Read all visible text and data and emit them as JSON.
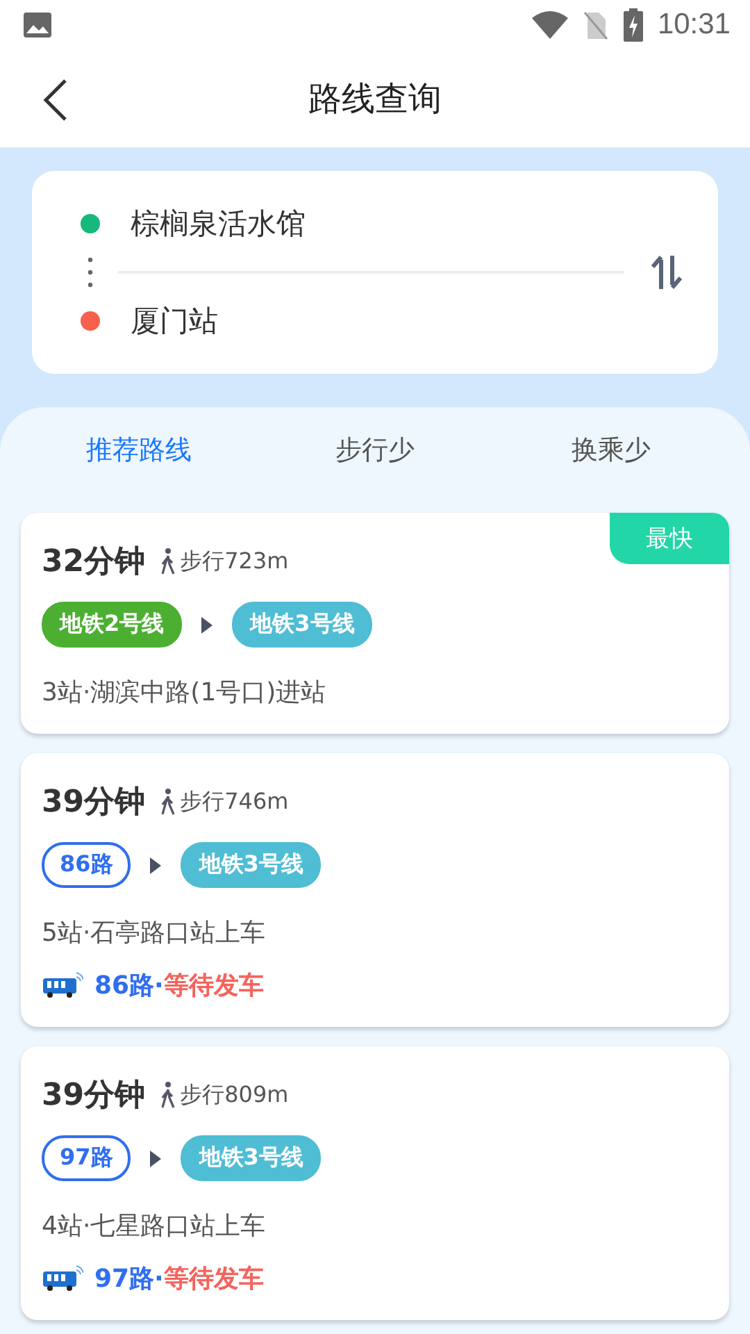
{
  "status_bar": {
    "time": "10:31"
  },
  "header": {
    "title": "路线查询"
  },
  "search": {
    "origin": "棕榈泉活水馆",
    "destination": "厦门站"
  },
  "tabs": [
    {
      "label": "推荐路线",
      "selected": true
    },
    {
      "label": "步行少",
      "selected": false
    },
    {
      "label": "换乘少",
      "selected": false
    }
  ],
  "routes": [
    {
      "duration": "32分钟",
      "walk": "步行723m",
      "badge": "最快",
      "segments": [
        {
          "kind": "subway",
          "label": "地铁2号线",
          "color": "#4caf32"
        },
        {
          "kind": "subway",
          "label": "地铁3号线",
          "color": "#4fbdd4"
        }
      ],
      "info": "3站·湖滨中路(1号口)进站"
    },
    {
      "duration": "39分钟",
      "walk": "步行746m",
      "segments": [
        {
          "kind": "bus",
          "label": "86路"
        },
        {
          "kind": "subway",
          "label": "地铁3号线",
          "color": "#4fbdd4"
        }
      ],
      "info": "5站·石亭路口站上车",
      "realtime": {
        "line": "86路·",
        "status": "等待发车"
      }
    },
    {
      "duration": "39分钟",
      "walk": "步行809m",
      "segments": [
        {
          "kind": "bus",
          "label": "97路"
        },
        {
          "kind": "subway",
          "label": "地铁3号线",
          "color": "#4fbdd4"
        }
      ],
      "info": "4站·七星路口站上车",
      "realtime": {
        "line": "97路·",
        "status": "等待发车"
      }
    }
  ]
}
